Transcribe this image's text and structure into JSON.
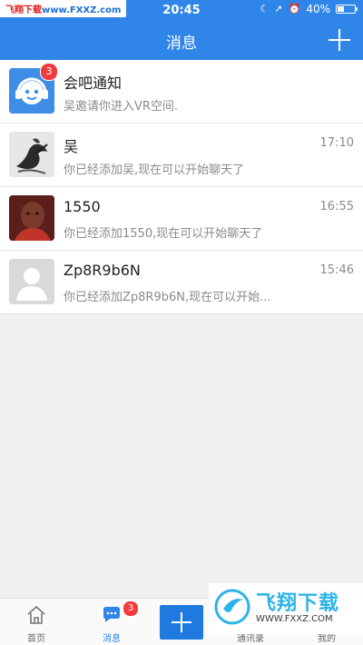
{
  "watermark_top": {
    "prefix": "飞翔下载",
    "url": "www.FXXZ.com"
  },
  "status_bar": {
    "time": "20:45",
    "battery": "40%",
    "battery_level": 0.4
  },
  "nav": {
    "title": "消息",
    "add_icon": "plus-icon"
  },
  "conversations": [
    {
      "name": "会吧通知",
      "preview": "吴邀请你进入VR空间.",
      "time": "",
      "badge": "3",
      "avatar": "robot-headphones-icon"
    },
    {
      "name": "吴",
      "preview": "你已经添加吴,现在可以开始聊天了",
      "time": "17:10",
      "badge": "",
      "avatar": "ink-figure-avatar"
    },
    {
      "name": "1550",
      "preview": "你已经添加1550,现在可以开始聊天了",
      "time": "16:55",
      "badge": "",
      "avatar": "photo-avatar"
    },
    {
      "name": "Zp8R9b6N",
      "preview": "你已经添加Zp8R9b6N,现在可以开始...",
      "time": "15:46",
      "badge": "",
      "avatar": "default-user-avatar"
    }
  ],
  "tabbar": {
    "tabs": [
      {
        "label": "首页",
        "icon": "home-icon",
        "active": false
      },
      {
        "label": "消息",
        "icon": "chat-icon",
        "active": true,
        "badge": "3"
      },
      {
        "label": "",
        "icon": "plus-icon"
      },
      {
        "label": "通讯录",
        "icon": "contacts-icon",
        "active": false
      },
      {
        "label": "我的",
        "icon": "profile-icon",
        "active": false
      }
    ]
  },
  "watermark_bottom": {
    "brand": "飞翔下载",
    "url": "WWW.FXXZ.COM"
  },
  "colors": {
    "primary": "#2f86e8",
    "badge": "#f23c3c",
    "background": "#f0f0f2"
  }
}
